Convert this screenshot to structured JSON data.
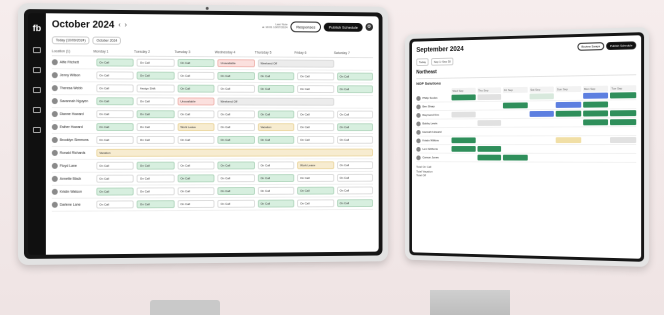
{
  "colors": {
    "accent_green": "#2f8f5b",
    "light_green": "#d7efdf",
    "light_red": "#fbe0de",
    "light_yellow": "#f7ecd0",
    "accent_blue": "#5d7fe0"
  },
  "left": {
    "rail": {
      "logo": "fb",
      "items": [
        {
          "icon": "calendar-icon",
          "label": ""
        },
        {
          "icon": "people-icon",
          "label": ""
        },
        {
          "icon": "clipboard-icon",
          "label": ""
        },
        {
          "icon": "chat-icon",
          "label": ""
        },
        {
          "icon": "user-icon",
          "label": ""
        }
      ]
    },
    "header": {
      "month": "October 2024",
      "last_note": "Last Note",
      "last_note_sub": "at 10:01 10/07/2024",
      "responses_label": "Responses",
      "publish_label": "Publish Schedule"
    },
    "subbar": {
      "chip_today": "Today (10/09/2024)",
      "chip_range": "October 2024"
    },
    "columns": [
      "Location (1)",
      "Monday 1",
      "Tuesday 2",
      "Tuesday 3",
      "Wednesday 4",
      "Thursday 5",
      "Friday 6",
      "Saturday 7"
    ],
    "people": [
      {
        "name": "Alfie Fitchett",
        "cells": [
          [
            "On Call",
            "g"
          ],
          [
            "On Call",
            "w"
          ],
          [
            "On Call",
            "g"
          ],
          [
            "Unavailable",
            "r"
          ],
          [
            "Weekend Off",
            "gray",
            2
          ],
          [
            "",
            ""
          ]
        ]
      },
      {
        "name": "Jenny Wilson",
        "cells": [
          [
            "On Call",
            "w"
          ],
          [
            "On Call",
            "g"
          ],
          [
            "On Call",
            "w"
          ],
          [
            "On Call",
            "g"
          ],
          [
            "On Call",
            "g"
          ],
          [
            "On Call",
            "w"
          ],
          [
            "On Call",
            "g"
          ]
        ]
      },
      {
        "name": "Theresa Webb",
        "cells": [
          [
            "On Call",
            "w"
          ],
          [
            "Assign Shift",
            "w"
          ],
          [
            "On Call",
            "g"
          ],
          [
            "On Call",
            "w"
          ],
          [
            "On Call",
            "g"
          ],
          [
            "On Call",
            "w"
          ],
          [
            "On Call",
            "g"
          ]
        ]
      },
      {
        "name": "Savannah Nguyen",
        "cells": [
          [
            "On Call",
            "g"
          ],
          [
            "On Call",
            "w"
          ],
          [
            "Unavailable",
            "r"
          ],
          [
            "Weekend Off",
            "gray",
            3
          ],
          [
            "",
            ""
          ],
          [
            "",
            ""
          ]
        ]
      },
      {
        "name": "Dianne Howard",
        "cells": [
          [
            "On Call",
            "w"
          ],
          [
            "On Call",
            "g"
          ],
          [
            "On Call",
            "w"
          ],
          [
            "On Call",
            "w"
          ],
          [
            "On Call",
            "g"
          ],
          [
            "On Call",
            "w"
          ],
          [
            "On Call",
            "w"
          ]
        ]
      },
      {
        "name": "Esther Howard",
        "cells": [
          [
            "On Call",
            "g"
          ],
          [
            "On Call",
            "w"
          ],
          [
            "Work Leave",
            "y"
          ],
          [
            "On Call",
            "w"
          ],
          [
            "Vacation",
            "y"
          ],
          [
            "On Call",
            "w"
          ],
          [
            "On Call",
            "g"
          ]
        ]
      },
      {
        "name": "Brooklyn Simmons",
        "cells": [
          [
            "On Call",
            "w"
          ],
          [
            "On Call",
            "w"
          ],
          [
            "On Call",
            "w"
          ],
          [
            "On Call",
            "g"
          ],
          [
            "On Call",
            "g"
          ],
          [
            "On Call",
            "w"
          ],
          [
            "On Call",
            "w"
          ]
        ]
      },
      {
        "name": "Ronald Richards",
        "cells": [
          [
            "Vacation",
            "y",
            7
          ]
        ]
      },
      {
        "name": "Floyd Lane",
        "cells": [
          [
            "On Call",
            "w"
          ],
          [
            "On Call",
            "g"
          ],
          [
            "On Call",
            "w"
          ],
          [
            "On Call",
            "g"
          ],
          [
            "On Call",
            "w"
          ],
          [
            "Work Leave",
            "y"
          ],
          [
            "On Call",
            "w"
          ]
        ]
      },
      {
        "name": "Annette Black",
        "cells": [
          [
            "On Call",
            "w"
          ],
          [
            "On Call",
            "w"
          ],
          [
            "On Call",
            "g"
          ],
          [
            "On Call",
            "w"
          ],
          [
            "On Call",
            "g"
          ],
          [
            "On Call",
            "w"
          ],
          [
            "On Call",
            "w"
          ]
        ]
      },
      {
        "name": "Kristin Watson",
        "cells": [
          [
            "On Call",
            "g"
          ],
          [
            "On Call",
            "w"
          ],
          [
            "On Call",
            "w"
          ],
          [
            "On Call",
            "g"
          ],
          [
            "On Call",
            "w"
          ],
          [
            "On Call",
            "g"
          ],
          [
            "On Call",
            "w"
          ]
        ]
      },
      {
        "name": "Darlene Lane",
        "cells": [
          [
            "On Call",
            "w"
          ],
          [
            "On Call",
            "g"
          ],
          [
            "On Call",
            "w"
          ],
          [
            "On Call",
            "w"
          ],
          [
            "On Call",
            "g"
          ],
          [
            "On Call",
            "w"
          ],
          [
            "On Call",
            "g"
          ]
        ]
      }
    ]
  },
  "right": {
    "header": {
      "month": "September 2024",
      "btn_a": "Review Swaps",
      "btn_b": "Publish Schedule"
    },
    "sub_chip_a": "Today",
    "sub_chip_b": "Sep 1–Sep 30",
    "section": "Northeast",
    "team": "NOP Solutions",
    "cols": [
      "Wed Sep",
      "Thu Sep",
      "Fri Sep",
      "Sat Sep",
      "Sun Sep",
      "Mon Sep",
      "Tue Sep"
    ],
    "rows": [
      {
        "name": "Philip Scoles",
        "bars": [
          "g",
          "gray",
          "",
          "l",
          "",
          "b",
          "g"
        ]
      },
      {
        "name": "Ben Sharp",
        "bars": [
          "",
          "",
          "g",
          "",
          "b",
          "g",
          ""
        ]
      },
      {
        "name": "Raymond Kim",
        "bars": [
          "gray",
          "",
          "",
          "b",
          "g",
          "g",
          "g"
        ]
      },
      {
        "name": "Bobby Lewis",
        "bars": [
          "",
          "gray",
          "",
          "",
          "",
          "g",
          "g"
        ]
      },
      {
        "name": "Hannah Howard",
        "bars": [
          "",
          "",
          "",
          "",
          "",
          "",
          ""
        ]
      },
      {
        "name": "Kristin Wilkins",
        "bars": [
          "g",
          "",
          "",
          "",
          "y",
          "",
          "gray"
        ]
      },
      {
        "name": "Lexi Gibbons",
        "bars": [
          "g",
          "g",
          "",
          "",
          "",
          "",
          ""
        ]
      },
      {
        "name": "Carson Jones",
        "bars": [
          "",
          "g",
          "g",
          "",
          "",
          "",
          ""
        ]
      }
    ],
    "foot": [
      "Total On Call",
      "Total Vacation",
      "Total Off"
    ]
  }
}
